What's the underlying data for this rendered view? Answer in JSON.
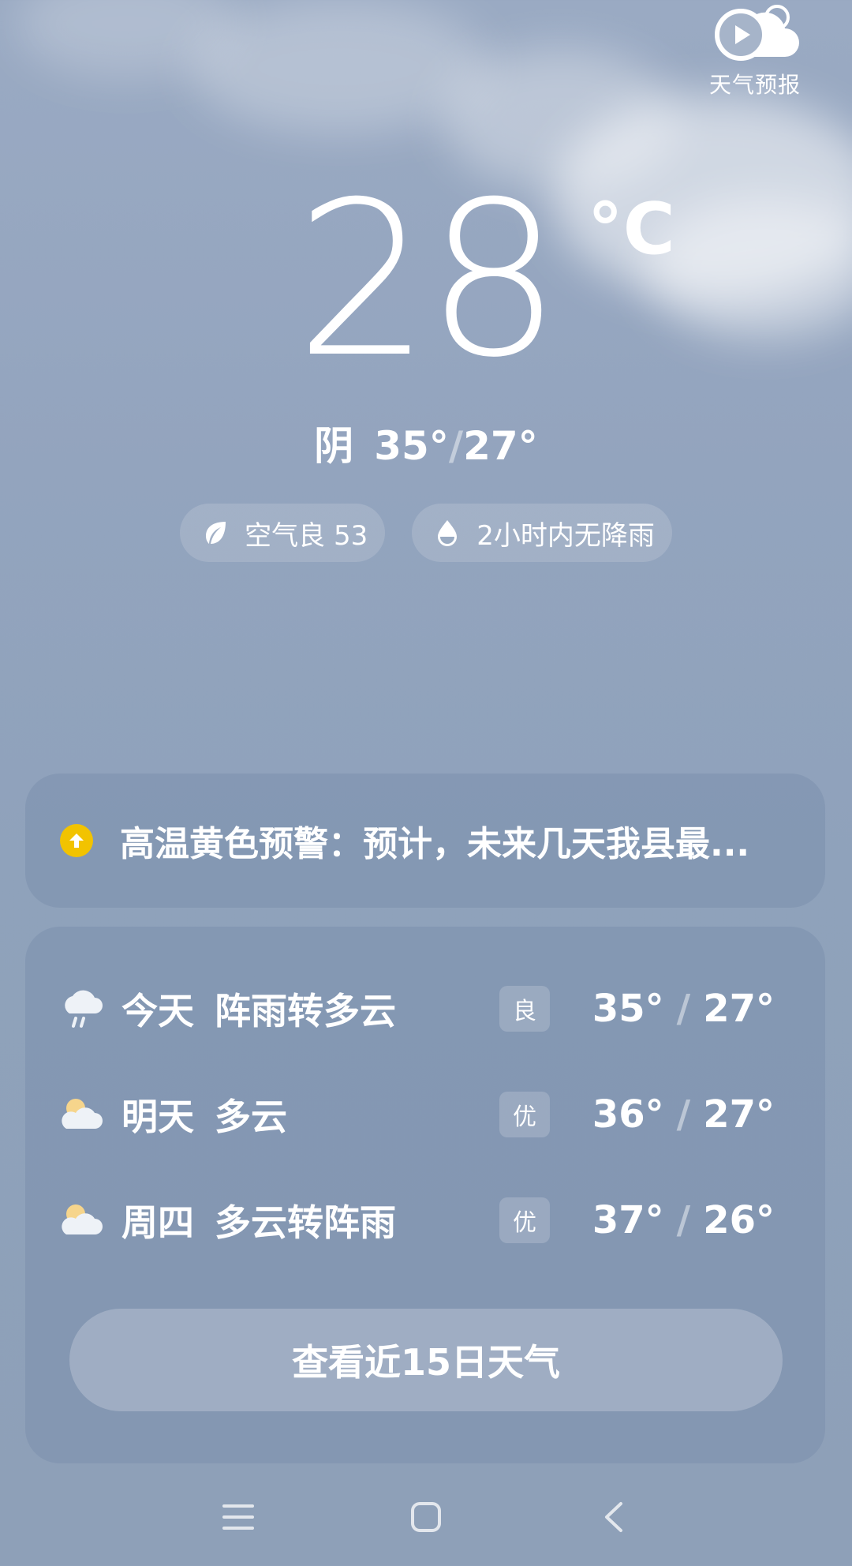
{
  "forecast_video": {
    "label": "天气预报",
    "icon": "play-cloud-icon"
  },
  "current": {
    "temperature": "28",
    "unit": "°C",
    "condition": "阴",
    "high": "35°",
    "separator": "/",
    "low": "27°"
  },
  "pills": [
    {
      "icon": "leaf-icon",
      "label": "空气良 53"
    },
    {
      "icon": "raindrop-icon",
      "label": "2小时内无降雨"
    }
  ],
  "alert": {
    "icon": "arrow-up-circle-icon",
    "color": "#f2c300",
    "text": "高温黄色预警：预计，未来几天我县最..."
  },
  "daily": [
    {
      "day": "今天",
      "condition": "阵雨转多云",
      "aqi": "良",
      "high": "35°",
      "sep": "/",
      "low": "27°",
      "icon": "shower-cloud-icon"
    },
    {
      "day": "明天",
      "condition": "多云",
      "aqi": "优",
      "high": "36°",
      "sep": "/",
      "low": "27°",
      "icon": "partly-cloudy-icon"
    },
    {
      "day": "周四",
      "condition": "多云转阵雨",
      "aqi": "优",
      "high": "37°",
      "sep": "/",
      "low": "26°",
      "icon": "partly-cloudy-icon"
    }
  ],
  "more_button": "查看近15日天气",
  "navbar": {
    "menu_icon": "menu-icon",
    "home_icon": "home-icon",
    "back_icon": "back-icon"
  }
}
